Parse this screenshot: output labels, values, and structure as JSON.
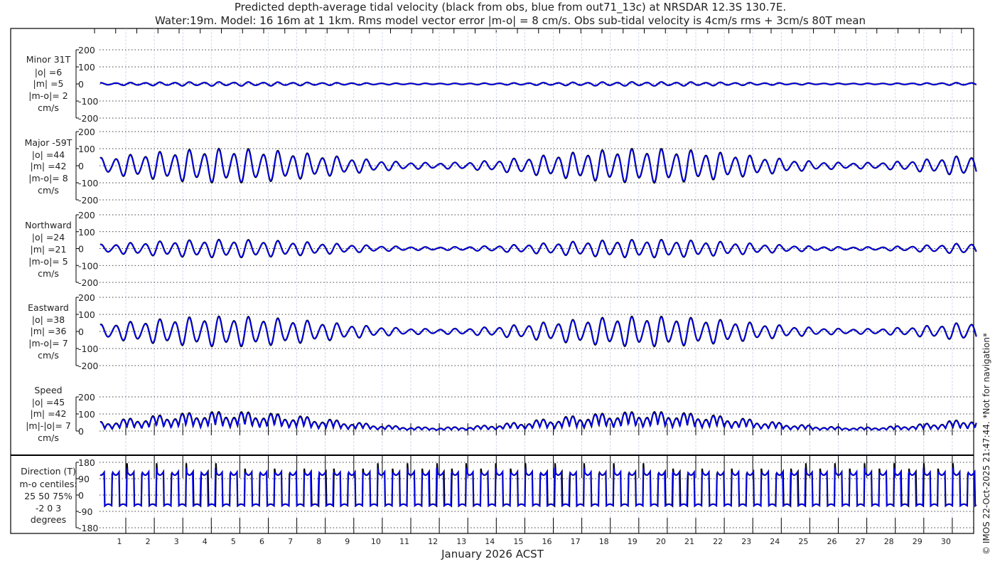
{
  "chart_data": {
    "type": "line",
    "title": [
      "Predicted depth-average tidal velocity (black from obs, blue from out71_13c) at NRSDAR 12.3S 130.7E.",
      "Water:19m. Model: 16 16m at 1 1km. Rms model vector error |m-o| = 8 cm/s. Obs sub-tidal velocity is 4cm/s rms + 3cm/s 80T mean"
    ],
    "xlabel": "January 2026 ACST",
    "xticks": [
      "1",
      "2",
      "3",
      "4",
      "5",
      "6",
      "7",
      "8",
      "9",
      "10",
      "11",
      "12",
      "13",
      "14",
      "15",
      "16",
      "17",
      "18",
      "19",
      "20",
      "21",
      "22",
      "23",
      "24",
      "25",
      "26",
      "27",
      "28",
      "29",
      "30"
    ],
    "xlim_days": [
      0,
      31
    ],
    "side_note": "© IMOS 22-Oct-2025 21:47:44. *Not for navigation*",
    "series_legend": [
      {
        "name": "obs",
        "color": "#000000"
      },
      {
        "name": "model",
        "color": "#0000ff"
      }
    ],
    "signal_model": {
      "semidiurnal_period_h": 12.42,
      "spring_neap_period_days": 14.77,
      "spring_peak_days": [
        4.5,
        21
      ]
    },
    "panels": [
      {
        "id": "minor",
        "labels": [
          "Minor 31T",
          "|o| =6",
          "|m| =5",
          "|m-o|= 2",
          "cm/s"
        ],
        "yticks": [
          "200",
          "100",
          "0",
          "-100",
          "-200"
        ],
        "ylim": [
          -200,
          200
        ],
        "amp_spring": 10,
        "amp_neap": 3
      },
      {
        "id": "major",
        "labels": [
          "Major -59T",
          "|o| =44",
          "|m| =42",
          "|m-o|= 8",
          "cm/s"
        ],
        "yticks": [
          "200",
          "100",
          "0",
          "-100",
          "-200"
        ],
        "ylim": [
          -200,
          200
        ],
        "amp_spring": 85,
        "amp_neap": 15
      },
      {
        "id": "north",
        "labels": [
          "Northward",
          "|o| =24",
          "|m| =21",
          "|m-o|= 5",
          "cm/s"
        ],
        "yticks": [
          "200",
          "100",
          "0",
          "-100",
          "-200"
        ],
        "ylim": [
          -200,
          200
        ],
        "amp_spring": 45,
        "amp_neap": 8
      },
      {
        "id": "east",
        "labels": [
          "Eastward",
          "|o| =38",
          "|m| =36",
          "|m-o|= 7",
          "cm/s"
        ],
        "yticks": [
          "200",
          "100",
          "0",
          "-100",
          "-200"
        ],
        "ylim": [
          -200,
          200
        ],
        "amp_spring": 75,
        "amp_neap": 13
      },
      {
        "id": "speed",
        "labels": [
          "Speed",
          "|o| =45",
          "|m| =42",
          "|m|-|o|= 7",
          "cm/s"
        ],
        "yticks": [
          "200",
          "100",
          "0"
        ],
        "ylim": [
          0,
          200
        ],
        "amp_spring": 95,
        "amp_neap": 18
      },
      {
        "id": "direction",
        "labels": [
          "Direction (T)",
          "m-o centiles:",
          "25  50  75%",
          "-2  0  3",
          "degrees"
        ],
        "yticks": [
          "180",
          "90",
          "0",
          "-90",
          "-180"
        ],
        "ylim": [
          -180,
          180
        ]
      }
    ]
  }
}
